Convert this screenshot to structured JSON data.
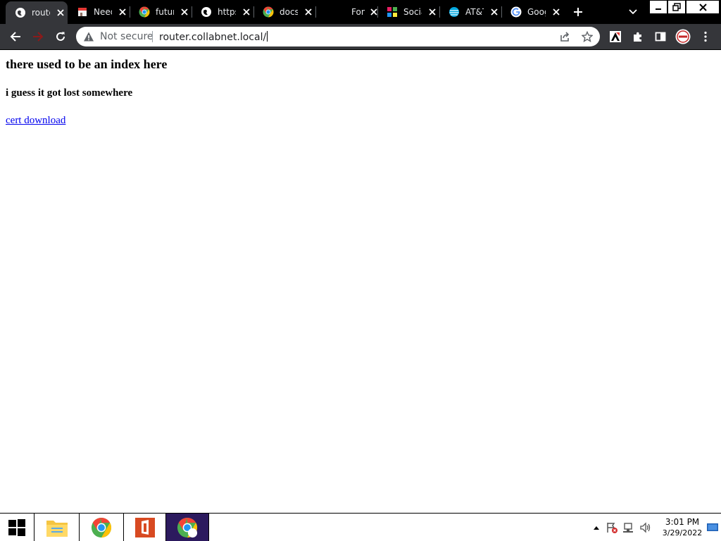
{
  "browser": {
    "tabs": [
      {
        "title": "router.collabnet.local",
        "favicon": "globe-icon",
        "active": true
      },
      {
        "title": "Need",
        "favicon": "shop-icon",
        "active": false
      },
      {
        "title": "future",
        "favicon": "chrome-logo-icon",
        "active": false
      },
      {
        "title": "https",
        "favicon": "globe-icon",
        "active": false
      },
      {
        "title": "docs",
        "favicon": "chrome-logo-icon",
        "active": false
      },
      {
        "title": "Fonts",
        "favicon": "",
        "active": false
      },
      {
        "title": "Social",
        "favicon": "social-icon",
        "active": false
      },
      {
        "title": "AT&T",
        "favicon": "att-icon",
        "active": false
      },
      {
        "title": "Google",
        "favicon": "google-icon",
        "active": false
      }
    ],
    "omnibox": {
      "security_label": "Not secure",
      "url": "router.collabnet.local/"
    }
  },
  "page": {
    "heading": "there used to be an index here",
    "subheading": "i guess it got lost somewhere",
    "link": "cert download"
  },
  "taskbar": {
    "time": "3:01 PM",
    "date": "3/29/2022"
  },
  "colors": {
    "tabstrip_bg": "#000000",
    "toolbar_bg": "#35363a",
    "link": "#0000ee",
    "taskbar_active": "#2c1a5e"
  }
}
